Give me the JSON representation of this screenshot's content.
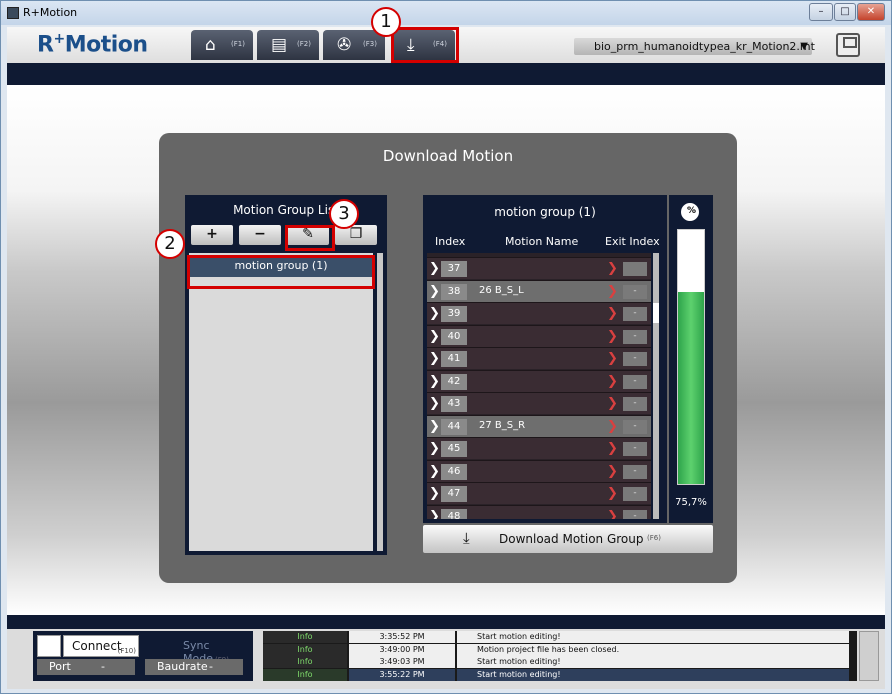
{
  "window": {
    "title": "R+Motion",
    "controls": {
      "minimize": "–",
      "maximize": "□",
      "close": "✕"
    }
  },
  "app": {
    "logo_main": "R",
    "logo_sup": "+",
    "logo_rest": "Motion"
  },
  "tabs": [
    {
      "icon": "home-icon",
      "glyph": "⌂",
      "key": "(F1)"
    },
    {
      "icon": "film-icon",
      "glyph": "▤",
      "key": "(F2)"
    },
    {
      "icon": "reel-icon",
      "glyph": "✇",
      "key": "(F3)"
    },
    {
      "icon": "download-icon",
      "glyph": "⤓",
      "key": "(F4)"
    }
  ],
  "file_selector": {
    "value": "bio_prm_humanoidtypea_kr_Motion2.mt",
    "arrow": "▼"
  },
  "markers": {
    "m1": "1",
    "m2": "2",
    "m3": "3"
  },
  "dialog": {
    "title": "Download Motion",
    "group_list": {
      "title": "Motion Group List",
      "add": "+",
      "remove": "−",
      "edit": "✎",
      "copy": "❐",
      "items": [
        "motion group (1)"
      ]
    },
    "group_panel": {
      "title": "motion group (1)",
      "col_index": "Index",
      "col_name": "Motion Name",
      "col_exit": "Exit Index",
      "rows": [
        {
          "index": "37",
          "name": "",
          "exit": ""
        },
        {
          "index": "38",
          "name": "26 B_S_L",
          "exit": "-"
        },
        {
          "index": "39",
          "name": "",
          "exit": "-"
        },
        {
          "index": "40",
          "name": "",
          "exit": "-"
        },
        {
          "index": "41",
          "name": "",
          "exit": "-"
        },
        {
          "index": "42",
          "name": "",
          "exit": "-"
        },
        {
          "index": "43",
          "name": "",
          "exit": "-"
        },
        {
          "index": "44",
          "name": "27 B_S_R",
          "exit": "-"
        },
        {
          "index": "45",
          "name": "",
          "exit": "-"
        },
        {
          "index": "46",
          "name": "",
          "exit": "-"
        },
        {
          "index": "47",
          "name": "",
          "exit": "-"
        },
        {
          "index": "48",
          "name": "",
          "exit": "-"
        }
      ]
    },
    "download_button": {
      "label": "Download Motion Group",
      "key": "(F6)"
    },
    "memory_gauge": {
      "percent_text": "75,7%",
      "fraction": 0.757
    }
  },
  "status": {
    "connect": "Connect",
    "connect_key": "(F10)",
    "sync_mode": "Sync Mode",
    "sync_key": "(F9)",
    "port": "Port",
    "baudrate": "Baudrate",
    "dash": "-",
    "log": [
      {
        "level": "Info",
        "time": "3:35:52 PM",
        "message": "Start motion editing!"
      },
      {
        "level": "Info",
        "time": "3:49:00 PM",
        "message": "Motion project file has been closed."
      },
      {
        "level": "Info",
        "time": "3:49:03 PM",
        "message": "Start motion editing!"
      },
      {
        "level": "Info",
        "time": "3:55:22 PM",
        "message": "Start motion editing!"
      }
    ]
  },
  "colors": {
    "navy": "#0f1a33",
    "highlight": "#d40000",
    "gauge_green": "#2ea44b"
  }
}
